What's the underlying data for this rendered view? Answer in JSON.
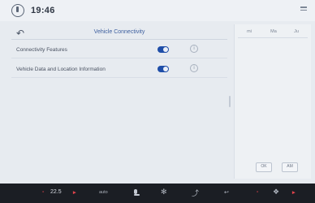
{
  "status_bar": {
    "time": "19:46",
    "power_icon": "power-icon",
    "menu_icon": "grid-icon"
  },
  "main": {
    "title": "Vehicle Connectivity",
    "back_icon": "back-arrow-icon",
    "rows": [
      {
        "label": "Connectivity Features",
        "toggle_on": true,
        "info_icon": "info-icon"
      },
      {
        "label": "Vehicle Data and Location Information",
        "toggle_on": true,
        "info_icon": "info-icon"
      }
    ]
  },
  "side_panel": {
    "headers": [
      "mi",
      "Ma",
      "Ju"
    ],
    "buttons": [
      "OK",
      "AM"
    ]
  },
  "bottom_bar": {
    "left_temp": "22.5",
    "auto_label": "auto",
    "accent_color": "#e2434b"
  }
}
